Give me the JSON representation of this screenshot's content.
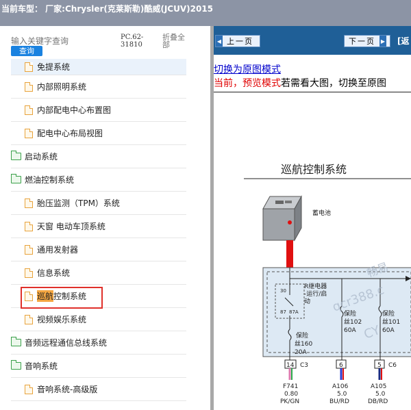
{
  "titlebar": {
    "text": "当前车型： 厂家:Chrysler(克莱斯勒)酷威(JCUV)2015"
  },
  "left": {
    "search_placeholder": "输入关键字查询",
    "search_button": "查询",
    "pc_code": "PC.62-31810",
    "collapse_all": "折叠全部"
  },
  "tree": [
    {
      "label": "免提系统",
      "type": "file",
      "partial": true
    },
    {
      "label": "内部照明系统",
      "type": "file"
    },
    {
      "label": "内部配电中心布置图",
      "type": "file"
    },
    {
      "label": "配电中心布局视图",
      "type": "file"
    },
    {
      "label": "启动系统",
      "type": "folder"
    },
    {
      "label": "燃油控制系统",
      "type": "folder"
    },
    {
      "label": "胎压监测（TPM）系统",
      "type": "file"
    },
    {
      "label": "天窗 电动车顶系统",
      "type": "file"
    },
    {
      "label": "通用发射器",
      "type": "file"
    },
    {
      "label": "信息系统",
      "type": "file"
    },
    {
      "label_hl": "巡航",
      "label_rest": "控制系统",
      "type": "file",
      "selected": true
    },
    {
      "label": "视频娱乐系统",
      "type": "file"
    },
    {
      "label": "音频远程通信总线系统",
      "type": "folder"
    },
    {
      "label": "音响系统",
      "type": "folder"
    },
    {
      "label": "音响系统-高级版",
      "type": "file"
    }
  ],
  "right": {
    "prev_button": "上一页",
    "next_button": "下一页",
    "nav_extra": "[返",
    "switch_link": "切换为原图模式",
    "mode_prefix": "当前，预览模式",
    "mode_suffix": "若需看大图，切换至原图"
  },
  "diagram": {
    "title": "巡航控制系统",
    "battery_label": "蓄电池",
    "relay_label": [
      "R继电器",
      "-运行/启",
      "动"
    ],
    "relay_pins": [
      "30",
      "87",
      "87A"
    ],
    "fuse_main": [
      "保险",
      "丝160",
      "20A"
    ],
    "fuse_b": [
      "保险",
      "丝102",
      "60A"
    ],
    "fuse_c": [
      "保险",
      "丝101",
      "60A"
    ],
    "connectors": [
      {
        "pin": "14",
        "conn": "C3"
      },
      {
        "pin": "6",
        "conn": ""
      },
      {
        "pin": "5",
        "conn": "C6"
      }
    ],
    "wires": [
      {
        "id": "F741",
        "gauge": "0.80",
        "color": "PK/GN"
      },
      {
        "id": "A106",
        "gauge": "5.0",
        "color": "BU/RD"
      },
      {
        "id": "A105",
        "gauge": "5.0",
        "color": "DB/RD"
      }
    ],
    "watermark": [
      "畅易",
      "qcr388.c",
      "CY"
    ],
    "colors": {
      "box_fill": "#dde9f4",
      "red_wire": "#e01010",
      "battery": "#9fa3a8"
    }
  }
}
